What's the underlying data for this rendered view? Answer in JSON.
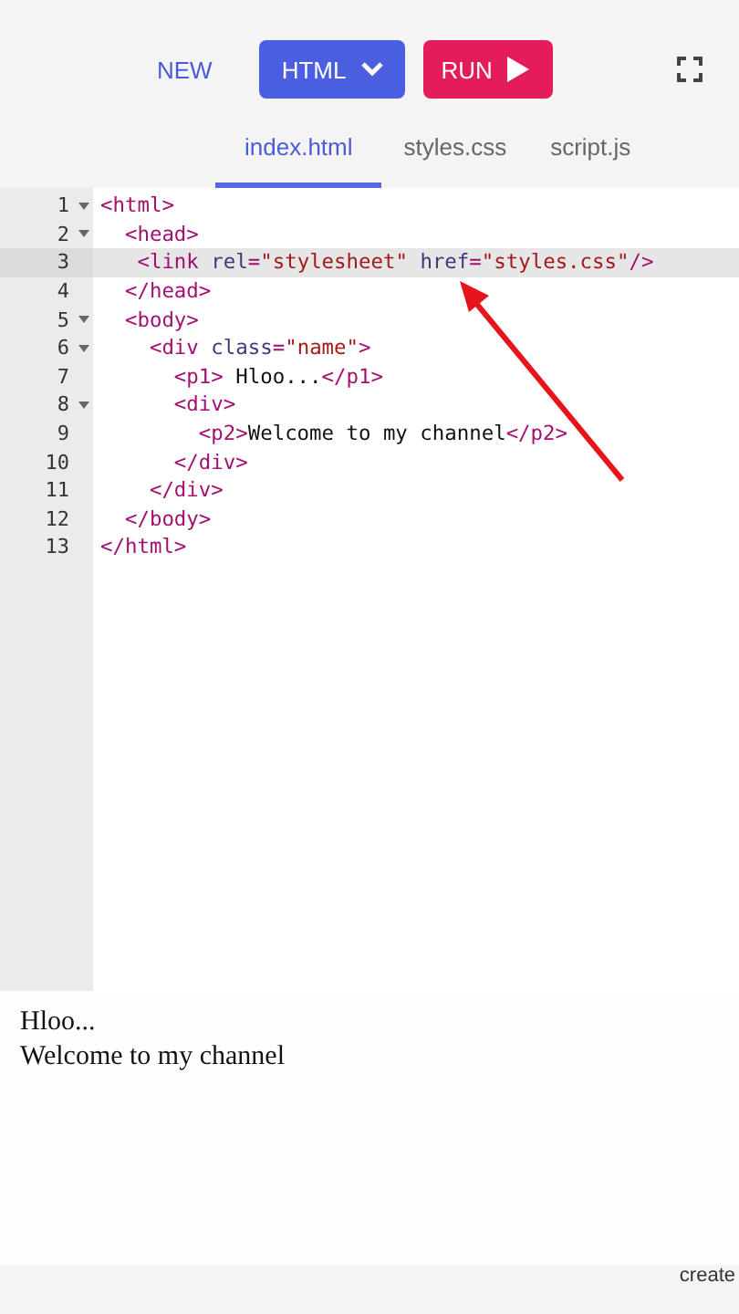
{
  "toolbar": {
    "new_label": "NEW",
    "language_button": "HTML",
    "run_button": "RUN"
  },
  "tabs": [
    {
      "label": "index.html",
      "selected": true
    },
    {
      "label": "styles.css",
      "selected": false
    },
    {
      "label": "script.js",
      "selected": false
    }
  ],
  "editor": {
    "lines": [
      {
        "number": "1",
        "text": "<html>",
        "foldable": true,
        "highlighted": false
      },
      {
        "number": "2",
        "text": "  <head>",
        "foldable": true,
        "highlighted": false
      },
      {
        "number": "3",
        "text": "   <link rel=\"stylesheet\" href=\"styles.css\"/>",
        "foldable": false,
        "highlighted": true
      },
      {
        "number": "4",
        "text": "  </head>",
        "foldable": false,
        "highlighted": false
      },
      {
        "number": "5",
        "text": "  <body>",
        "foldable": true,
        "highlighted": false
      },
      {
        "number": "6",
        "text": "    <div class=\"name\">",
        "foldable": true,
        "highlighted": false
      },
      {
        "number": "7",
        "text": "      <p1> Hloo...</p1>",
        "foldable": false,
        "highlighted": false
      },
      {
        "number": "8",
        "text": "      <div>",
        "foldable": true,
        "highlighted": false
      },
      {
        "number": "9",
        "text": "        <p2>Welcome to my channel</p2>",
        "foldable": false,
        "highlighted": false
      },
      {
        "number": "10",
        "text": "      </div>",
        "foldable": false,
        "highlighted": false
      },
      {
        "number": "11",
        "text": "    </div>",
        "foldable": false,
        "highlighted": false
      },
      {
        "number": "12",
        "text": "  </body>",
        "foldable": false,
        "highlighted": false
      },
      {
        "number": "13",
        "text": "</html>",
        "foldable": false,
        "highlighted": false
      }
    ]
  },
  "preview": {
    "lines": [
      "Hloo...",
      "Welcome to my channel"
    ]
  },
  "footer": {
    "text": "create"
  }
}
